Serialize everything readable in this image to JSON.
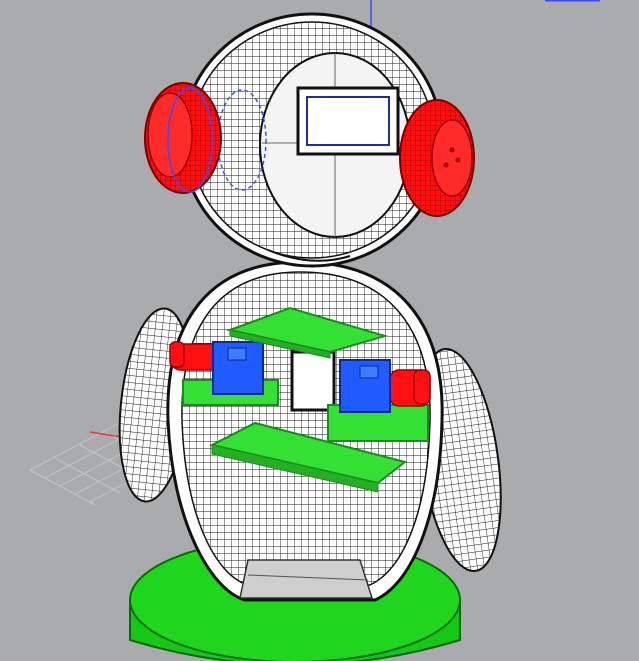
{
  "viewport": {
    "background": "#a9abad",
    "mode": "wireframe-shaded",
    "colors": {
      "shell": "#ffffff",
      "mesh": "#1a1a1a",
      "ear": "#ff1010",
      "ear_mesh": "#a00000",
      "board": "#33e033",
      "board_edge": "#1c8a1c",
      "servo": "#1f5bff",
      "servo_edge": "#0a2a99",
      "base": "#15c815",
      "base_edge": "#0b6a0b",
      "axis_blue": "#3a4cff",
      "grid": "#c7c9cb"
    }
  },
  "scene": {
    "objects": [
      {
        "name": "head-shell",
        "type": "mesh"
      },
      {
        "name": "face-screen",
        "type": "rectangle"
      },
      {
        "name": "left-ear",
        "type": "mesh"
      },
      {
        "name": "right-ear",
        "type": "mesh"
      },
      {
        "name": "body-shell",
        "type": "mesh"
      },
      {
        "name": "upper-board",
        "type": "pcb"
      },
      {
        "name": "lower-board",
        "type": "pcb"
      },
      {
        "name": "left-servo",
        "type": "servo"
      },
      {
        "name": "right-servo",
        "type": "servo"
      },
      {
        "name": "left-arm",
        "type": "mesh"
      },
      {
        "name": "right-arm",
        "type": "mesh"
      },
      {
        "name": "base-disc",
        "type": "cylinder"
      }
    ]
  }
}
